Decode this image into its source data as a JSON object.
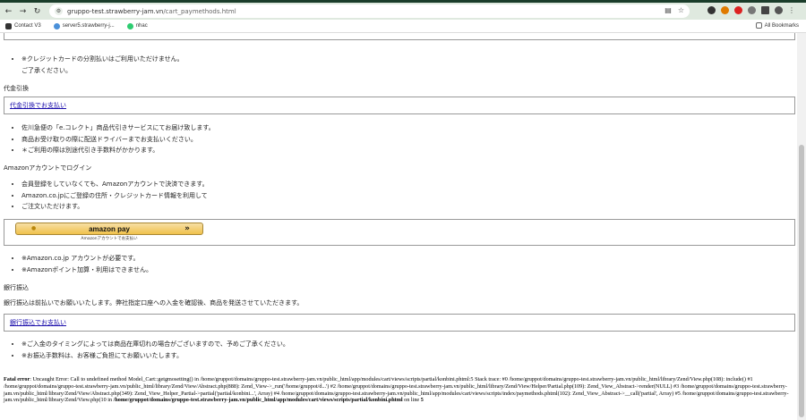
{
  "browser": {
    "url_domain": "gruppo-test.strawberry-jam.vn",
    "url_path": "/cart_paymethods.html",
    "bookmarks": [
      "Contact V3",
      "server5.strawberry-j...",
      "nhac"
    ],
    "all_bookmarks": "All Bookmarks",
    "colors": {
      "toolbar": "#dfe9df",
      "link": "#1a0dab"
    }
  },
  "page": {
    "credit_notes": [
      "※クレジットカードの分割払いはご利用いただけません。",
      "ご了承ください。"
    ],
    "cod": {
      "heading": "代金引換",
      "link": "代金引換でお支払い",
      "notes": [
        "佐川急便の「e.コレクト」商品代引きサービスにてお届け致します。",
        "商品お受け取りの際に配送ドライバーまでお支払いください。",
        "＊ご利用の際は別途代引き手数料がかかります。"
      ]
    },
    "amazon": {
      "heading": "Amazonアカウントでログイン",
      "notes": [
        "会員登録をしていなくても、Amazonアカウントで決済できます。",
        "Amazon.co.jpにご登録の住所・クレジットカード情報を利用して",
        "ご注文いただけます。"
      ],
      "button_logo": "amazon pay",
      "button_caption": "Amazonアカウントでお支払い",
      "after_notes": [
        "※Amazon.co.jp アカウントが必要です。",
        "※Amazonポイント加算・利用はできません。"
      ]
    },
    "bank": {
      "heading": "銀行振込",
      "desc": "銀行振込は前払いでお願いいたします。弊社指定口座への入金を確認後、商品を発送させていただきます。",
      "link": "銀行振込でお支払い",
      "notes": [
        "※ご入金のタイミングによっては商品在庫切れの場合がございますので、予めご了承ください。",
        "※お振込手数料は、お客様ご負担にてお願いいたします。"
      ]
    },
    "error": {
      "label": "Fatal error",
      "message": ": Uncaught Error: Call to undefined method Model_Cart::getgmosetting() in /home/gruppot/domains/gruppo-test.strawberry-jam.vn/public_html/app/modules/cart/views/scripts/partial/konbini.phtml:5 Stack trace: #0 /home/gruppot/domains/gruppo-test.strawberry-jam.vn/public_html/library/Zend/View.php(108): include() #1 /home/gruppot/domains/gruppo-test.strawberry-jam.vn/public_html/library/Zend/View/Abstract.php(888): Zend_View->_run('/home/gruppot/d...') #2 /home/gruppot/domains/gruppo-test.strawberry-jam.vn/public_html/library/Zend/View/Helper/Partial.php(109): Zend_View_Abstract->render(NULL) #3 /home/gruppot/domains/gruppo-test.strawberry-jam.vn/public_html/library/Zend/View/Abstract.php(349): Zend_View_Helper_Partial->partial('partial/konbini...', Array) #4 /home/gruppot/domains/gruppo-test.strawberry-jam.vn/public_html/app/modules/cart/views/scripts/index/paymethods.phtml(102): Zend_View_Abstract->__call('partial', Array) #5 /home/gruppot/domains/gruppo-test.strawberry-jam.vn/public_html/library/Zend/View.php(10 in ",
      "file": "/home/gruppot/domains/gruppo-test.strawberry-jam.vn/public_html/app/modules/cart/views/scripts/partial/konbini.phtml",
      "line_label": " on line ",
      "line": "5"
    }
  }
}
